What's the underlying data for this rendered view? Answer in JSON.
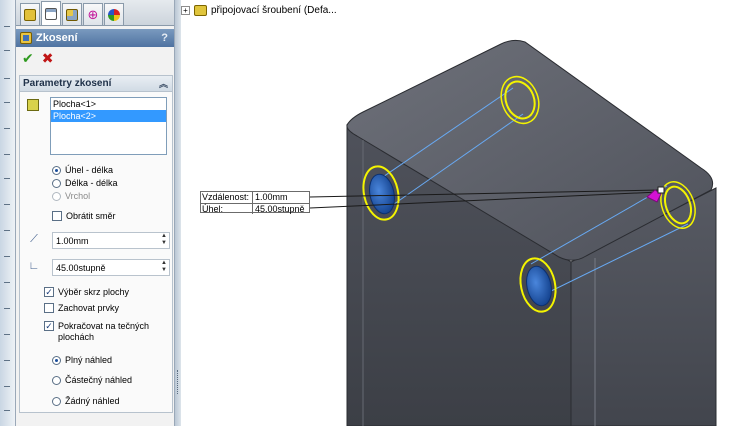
{
  "tree": {
    "part_label": "připojovací šroubení  (Defa..."
  },
  "panel": {
    "tabs": [
      "feature-manager",
      "property-manager",
      "configuration-manager",
      "dimxpert",
      "display-manager"
    ],
    "title": "Zkosení",
    "help": "?"
  },
  "chamfer": {
    "group_title": "Parametry zkosení",
    "faces": [
      "Plocha<1>",
      "Plocha<2>"
    ],
    "selected_face_index": 1,
    "type_options": [
      {
        "label": "Úhel - délka",
        "selected": true,
        "enabled": true
      },
      {
        "label": "Délka - délka",
        "selected": false,
        "enabled": true
      },
      {
        "label": "Vrchol",
        "selected": false,
        "enabled": false
      }
    ],
    "flip_direction": {
      "label": "Obrátit směr",
      "checked": false
    },
    "distance_value": "1.00mm",
    "angle_value": "45.00stupně",
    "options": [
      {
        "label": "Výběr skrz plochy",
        "checked": true
      },
      {
        "label": "Zachovat prvky",
        "checked": false
      },
      {
        "label": "Pokračovat na tečných plochách",
        "checked": true
      }
    ],
    "preview_options": [
      {
        "label": "Plný náhled",
        "selected": true
      },
      {
        "label": "Částečný náhled",
        "selected": false
      },
      {
        "label": "Žádný náhled",
        "selected": false
      }
    ]
  },
  "callout": {
    "distance_label": "Vzdálenost:",
    "distance_value": "1.00mm",
    "angle_label": "Úhel:",
    "angle_value": "45.00stupně"
  },
  "colors": {
    "title_bar": "#5a7dab",
    "face_selection": "#3399ff",
    "highlight_edge": "#f4f400",
    "model_gray": "#5b5e66",
    "hole_blue": "#2057b0",
    "marker": "#d412d4"
  }
}
